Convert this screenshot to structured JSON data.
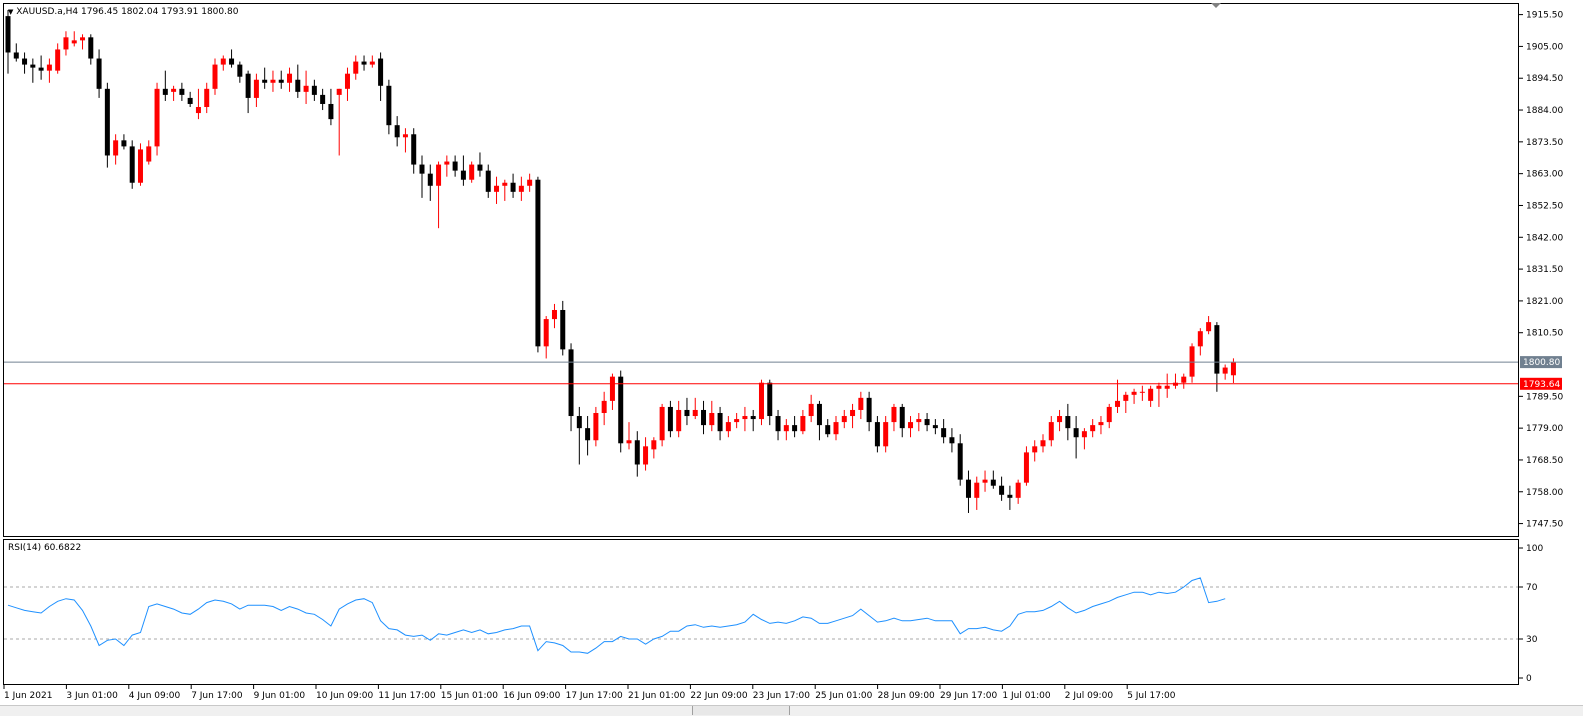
{
  "chart": {
    "symbol_header": "XAUUSD.a,H4  1796.45 1802.04 1793.91 1800.80",
    "price_axis": {
      "min": 1743.4,
      "max": 1919.0,
      "ticks": [
        "1915.50",
        "1905.00",
        "1894.50",
        "1884.00",
        "1873.50",
        "1863.00",
        "1852.50",
        "1842.00",
        "1831.50",
        "1821.00",
        "1810.50",
        "1800.80",
        "1789.50",
        "1779.00",
        "1768.50",
        "1758.00",
        "1747.50"
      ]
    },
    "current_price": {
      "value": 1800.8,
      "label": "1800.80",
      "color": "#708090"
    },
    "red_line": {
      "value": 1793.64,
      "label": "1793.64",
      "color": "#ff0000"
    },
    "colors": {
      "bull": "#ff0000",
      "bear": "#000000",
      "rsi": "#1e90ff",
      "grid": "#a9a9a9"
    }
  },
  "rsi": {
    "label": "RSI(14) 60.6822",
    "levels": [
      70,
      30
    ],
    "axis_ticks": [
      "100",
      "70",
      "30",
      "0"
    ]
  },
  "time_axis": {
    "labels": [
      "1 Jun 2021",
      "3 Jun 01:00",
      "4 Jun 09:00",
      "7 Jun 17:00",
      "9 Jun 01:00",
      "10 Jun 09:00",
      "11 Jun 17:00",
      "15 Jun 01:00",
      "16 Jun 09:00",
      "17 Jun 17:00",
      "21 Jun 01:00",
      "22 Jun 09:00",
      "23 Jun 17:00",
      "25 Jun 01:00",
      "28 Jun 09:00",
      "29 Jun 17:00",
      "1 Jul 01:00",
      "2 Jul 09:00",
      "5 Jul 17:00"
    ]
  },
  "chart_data": {
    "type": "candlestick",
    "candles": [
      [
        1915,
        1917,
        1896,
        1903
      ],
      [
        1903,
        1906,
        1900,
        1901
      ],
      [
        1901,
        1903,
        1896,
        1899
      ],
      [
        1899,
        1901,
        1893,
        1898
      ],
      [
        1898,
        1902,
        1894,
        1897
      ],
      [
        1897,
        1901,
        1893,
        1899
      ],
      [
        1897,
        1906,
        1896,
        1904
      ],
      [
        1904,
        1910,
        1902,
        1908
      ],
      [
        1906,
        1910,
        1905,
        1907
      ],
      [
        1907,
        1909,
        1904,
        1908
      ],
      [
        1908,
        1909,
        1899,
        1901
      ],
      [
        1901,
        1904,
        1888,
        1891
      ],
      [
        1891,
        1893,
        1865,
        1869
      ],
      [
        1869,
        1876,
        1866,
        1874
      ],
      [
        1874,
        1876,
        1871,
        1872
      ],
      [
        1872,
        1874,
        1858,
        1860
      ],
      [
        1860,
        1873,
        1859,
        1871
      ],
      [
        1867,
        1874,
        1866,
        1872
      ],
      [
        1872,
        1893,
        1869,
        1891
      ],
      [
        1891,
        1897,
        1887,
        1889
      ],
      [
        1890,
        1892,
        1887,
        1891
      ],
      [
        1891,
        1893,
        1887,
        1889
      ],
      [
        1888,
        1890,
        1885,
        1886
      ],
      [
        1883,
        1891,
        1881,
        1885
      ],
      [
        1885,
        1893,
        1883,
        1891
      ],
      [
        1891,
        1901,
        1889,
        1899
      ],
      [
        1899,
        1902,
        1897,
        1901
      ],
      [
        1901,
        1904,
        1898,
        1899
      ],
      [
        1899,
        1900,
        1893,
        1895
      ],
      [
        1896,
        1897,
        1883,
        1888
      ],
      [
        1888,
        1896,
        1885,
        1894
      ],
      [
        1894,
        1898,
        1891,
        1893
      ],
      [
        1893,
        1897,
        1890,
        1894
      ],
      [
        1894,
        1897,
        1891,
        1893
      ],
      [
        1893,
        1898,
        1890,
        1896
      ],
      [
        1894,
        1899,
        1888,
        1890
      ],
      [
        1890,
        1897,
        1886,
        1892
      ],
      [
        1892,
        1894,
        1887,
        1889
      ],
      [
        1889,
        1891,
        1884,
        1886
      ],
      [
        1886,
        1891,
        1879,
        1881
      ],
      [
        1889,
        1891,
        1869,
        1891
      ],
      [
        1891,
        1898,
        1887,
        1896
      ],
      [
        1896,
        1902,
        1894,
        1900
      ],
      [
        1900,
        1902,
        1897,
        1899
      ],
      [
        1899,
        1902,
        1898,
        1900
      ],
      [
        1901,
        1903,
        1887,
        1892
      ],
      [
        1892,
        1894,
        1876,
        1879
      ],
      [
        1879,
        1882,
        1872,
        1875
      ],
      [
        1875,
        1878,
        1870,
        1876
      ],
      [
        1876,
        1878,
        1863,
        1866
      ],
      [
        1866,
        1869,
        1855,
        1863
      ],
      [
        1863,
        1866,
        1854,
        1859
      ],
      [
        1859,
        1867,
        1845,
        1866
      ],
      [
        1866,
        1869,
        1862,
        1867
      ],
      [
        1867,
        1869,
        1862,
        1864
      ],
      [
        1864,
        1869,
        1859,
        1861
      ],
      [
        1861,
        1867,
        1860,
        1866
      ],
      [
        1866,
        1870,
        1862,
        1864
      ],
      [
        1864,
        1866,
        1855,
        1857
      ],
      [
        1857,
        1862,
        1853,
        1859
      ],
      [
        1859,
        1861,
        1854,
        1860
      ],
      [
        1860,
        1863,
        1855,
        1857
      ],
      [
        1857,
        1862,
        1854,
        1859
      ],
      [
        1859,
        1863,
        1857,
        1861
      ],
      [
        1861,
        1862,
        1804,
        1806
      ],
      [
        1806,
        1816,
        1802,
        1815
      ],
      [
        1815,
        1820,
        1812,
        1818
      ],
      [
        1818,
        1821,
        1803,
        1805
      ],
      [
        1805,
        1807,
        1778,
        1783
      ],
      [
        1783,
        1786,
        1767,
        1779
      ],
      [
        1779,
        1783,
        1770,
        1775
      ],
      [
        1775,
        1786,
        1773,
        1784
      ],
      [
        1784,
        1791,
        1780,
        1788
      ],
      [
        1788,
        1797,
        1785,
        1796
      ],
      [
        1796,
        1798,
        1771,
        1774
      ],
      [
        1774,
        1781,
        1772,
        1775
      ],
      [
        1775,
        1778,
        1763,
        1767
      ],
      [
        1767,
        1776,
        1765,
        1773
      ],
      [
        1772,
        1776,
        1769,
        1775
      ],
      [
        1775,
        1787,
        1773,
        1786
      ],
      [
        1786,
        1788,
        1776,
        1778
      ],
      [
        1778,
        1788,
        1776,
        1785
      ],
      [
        1785,
        1789,
        1780,
        1783
      ],
      [
        1783,
        1789,
        1782,
        1785
      ],
      [
        1785,
        1788,
        1777,
        1780
      ],
      [
        1780,
        1788,
        1778,
        1784
      ],
      [
        1784,
        1786,
        1775,
        1778
      ],
      [
        1778,
        1783,
        1776,
        1781
      ],
      [
        1781,
        1784,
        1779,
        1782
      ],
      [
        1782,
        1786,
        1778,
        1783
      ],
      [
        1783,
        1785,
        1778,
        1782
      ],
      [
        1782,
        1795,
        1780,
        1794
      ],
      [
        1794,
        1795,
        1780,
        1783
      ],
      [
        1783,
        1785,
        1775,
        1778
      ],
      [
        1778,
        1782,
        1775,
        1780
      ],
      [
        1780,
        1783,
        1776,
        1778
      ],
      [
        1778,
        1785,
        1777,
        1783
      ],
      [
        1783,
        1790,
        1781,
        1787
      ],
      [
        1787,
        1788,
        1775,
        1780
      ],
      [
        1780,
        1782,
        1776,
        1777
      ],
      [
        1777,
        1783,
        1775,
        1781
      ],
      [
        1781,
        1785,
        1779,
        1783
      ],
      [
        1783,
        1787,
        1779,
        1785
      ],
      [
        1785,
        1791,
        1782,
        1789
      ],
      [
        1789,
        1791,
        1778,
        1781
      ],
      [
        1781,
        1783,
        1771,
        1773
      ],
      [
        1773,
        1783,
        1771,
        1781
      ],
      [
        1781,
        1787,
        1778,
        1786
      ],
      [
        1786,
        1787,
        1776,
        1779
      ],
      [
        1779,
        1783,
        1776,
        1781
      ],
      [
        1781,
        1784,
        1778,
        1782
      ],
      [
        1782,
        1784,
        1778,
        1780
      ],
      [
        1780,
        1782,
        1777,
        1779
      ],
      [
        1779,
        1782,
        1774,
        1776
      ],
      [
        1776,
        1779,
        1771,
        1774
      ],
      [
        1774,
        1777,
        1760,
        1762
      ],
      [
        1762,
        1765,
        1751,
        1756
      ],
      [
        1756,
        1763,
        1752,
        1761
      ],
      [
        1761,
        1765,
        1758,
        1762
      ],
      [
        1762,
        1765,
        1759,
        1760
      ],
      [
        1760,
        1763,
        1755,
        1757
      ],
      [
        1757,
        1760,
        1752,
        1756
      ],
      [
        1756,
        1762,
        1754,
        1761
      ],
      [
        1761,
        1773,
        1760,
        1771
      ],
      [
        1771,
        1775,
        1768,
        1773
      ],
      [
        1773,
        1777,
        1771,
        1775
      ],
      [
        1775,
        1783,
        1773,
        1781
      ],
      [
        1781,
        1785,
        1778,
        1783
      ],
      [
        1783,
        1787,
        1775,
        1779
      ],
      [
        1779,
        1783,
        1769,
        1776
      ],
      [
        1776,
        1779,
        1772,
        1778
      ],
      [
        1778,
        1782,
        1776,
        1780
      ],
      [
        1780,
        1783,
        1777,
        1781
      ],
      [
        1781,
        1787,
        1779,
        1786
      ],
      [
        1786,
        1795,
        1784,
        1788
      ],
      [
        1788,
        1791,
        1784,
        1790
      ],
      [
        1790,
        1792,
        1787,
        1791
      ],
      [
        1791,
        1793,
        1788,
        1791
      ],
      [
        1788,
        1793,
        1786,
        1792
      ],
      [
        1792,
        1794,
        1786,
        1793
      ],
      [
        1792,
        1797,
        1789,
        1793
      ],
      [
        1793,
        1797,
        1792,
        1794
      ],
      [
        1794,
        1797,
        1792,
        1796
      ],
      [
        1796,
        1807,
        1794,
        1806
      ],
      [
        1806,
        1812,
        1803,
        1811
      ],
      [
        1811,
        1816,
        1810,
        1814
      ],
      [
        1813,
        1814,
        1791,
        1797
      ],
      [
        1797,
        1800,
        1795,
        1799
      ],
      [
        1796.45,
        1802.04,
        1793.91,
        1800.8
      ]
    ],
    "rsi_values": [
      56,
      54,
      52,
      51,
      50,
      55,
      59,
      61,
      60,
      52,
      40,
      25,
      29,
      30,
      25,
      33,
      35,
      55,
      57,
      55,
      53,
      50,
      49,
      53,
      58,
      60,
      59,
      57,
      53,
      56,
      56,
      56,
      55,
      52,
      55,
      53,
      50,
      49,
      45,
      40,
      53,
      57,
      60,
      61,
      58,
      44,
      38,
      37,
      33,
      32,
      33,
      29,
      34,
      33,
      35,
      37,
      35,
      37,
      34,
      35,
      37,
      38,
      40,
      40,
      21,
      28,
      27,
      25,
      20,
      20,
      19,
      23,
      28,
      28,
      32,
      30,
      30,
      26,
      30,
      32,
      36,
      36,
      40,
      41,
      39,
      40,
      39,
      40,
      41,
      43,
      49,
      45,
      42,
      43,
      42,
      44,
      47,
      46,
      42,
      42,
      44,
      46,
      48,
      53,
      48,
      43,
      44,
      46,
      44,
      44,
      45,
      46,
      44,
      44,
      44,
      34,
      38,
      38,
      39,
      37,
      36,
      40,
      49,
      51,
      51,
      52,
      55,
      59,
      54,
      50,
      52,
      55,
      57,
      59,
      62,
      64,
      66,
      66,
      64,
      66,
      65,
      66,
      70,
      75,
      77,
      58,
      59,
      61
    ]
  }
}
